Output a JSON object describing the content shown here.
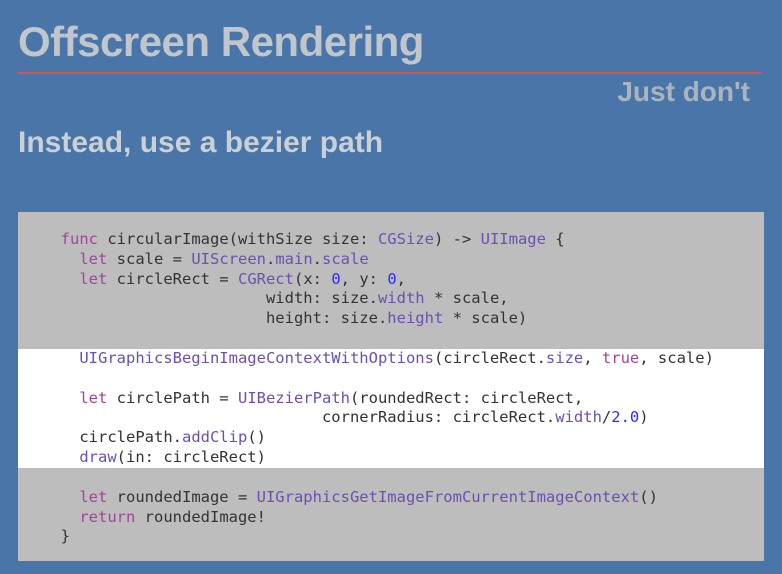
{
  "title": "Offscreen Rendering",
  "subtitle": "Just don't",
  "heading": "Instead, use a bezier path",
  "code": {
    "l1_func": "func",
    "l1_name": " circularImage(withSize size: ",
    "l1_type": "CGSize",
    "l1_arrow": ") -> ",
    "l1_ret": "UIImage",
    "l1_brace": " {",
    "l2_let": "let",
    "l2_rest1": " scale = ",
    "l2_ui": "UIScreen",
    "l2_dot1": ".",
    "l2_main": "main",
    "l2_dot2": ".",
    "l2_scale": "scale",
    "l3_let": "let",
    "l3_rest": " circleRect = ",
    "l3_ty": "CGRect",
    "l3_args1": "(x: ",
    "l3_z1": "0",
    "l3_args2": ", y: ",
    "l3_z2": "0",
    "l3_end": ",",
    "l4_pad": "                        width: size.",
    "l4_w": "width",
    "l4_rest": " * scale,",
    "l5_pad": "                        height: size.",
    "l5_h": "height",
    "l5_rest": " * scale)",
    "l6_fn": "UIGraphicsBeginImageContextWithOptions",
    "l6_args1": "(circleRect.",
    "l6_size": "size",
    "l6_mid": ", ",
    "l6_true": "true",
    "l6_end": ", scale)",
    "l7_let": "let",
    "l7_rest": " circlePath = ",
    "l7_ty": "UIBezierPath",
    "l7_args": "(roundedRect: circleRect,",
    "l8_pad": "                              cornerRadius: circleRect.",
    "l8_w": "width",
    "l8_div": "/",
    "l8_num": "2.0",
    "l8_end": ")",
    "l9a": "circlePath.",
    "l9b": "addClip",
    "l9c": "()",
    "l10a": "draw",
    "l10b": "(in: circleRect)",
    "l11_let": "let",
    "l11_rest": " roundedImage = ",
    "l11_fn": "UIGraphicsGetImageFromCurrentImageContext",
    "l11_end": "()",
    "l12_ret": "return",
    "l12_rest": " roundedImage!",
    "l13": "}"
  }
}
